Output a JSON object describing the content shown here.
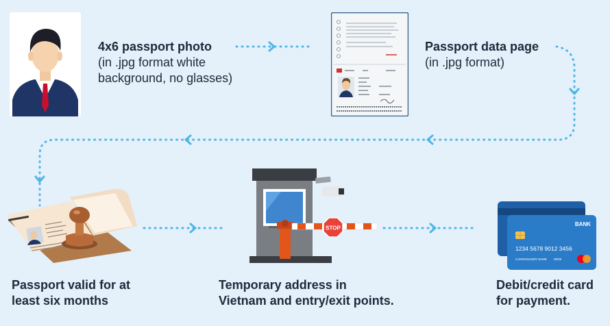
{
  "steps": {
    "photo": {
      "title": "4x6 passport photo",
      "detail_1": "(in .jpg format white",
      "detail_2": "background, no glasses)"
    },
    "data_page": {
      "title": "Passport data page",
      "detail_1": "(in .jpg format)"
    },
    "validity": {
      "line_1": "Passport valid for at",
      "line_2": "least six months"
    },
    "address": {
      "line_1": "Temporary address in",
      "line_2": "Vietnam and entry/exit points."
    },
    "payment": {
      "line_1": "Debit/credit card",
      "line_2": "for payment."
    }
  },
  "illustrations": {
    "barrier_sign": "STOP",
    "card_bank": "BANK",
    "card_number": "1234  5678  9012  3456",
    "card_holder": "CARDHOLDER NAME",
    "card_expiry": "00/00"
  },
  "colors": {
    "background": "#e4f0fa",
    "connector": "#4db6e8",
    "text": "#1c2a3a",
    "card": "#2a7cc9",
    "barrier": "#e2551b"
  }
}
